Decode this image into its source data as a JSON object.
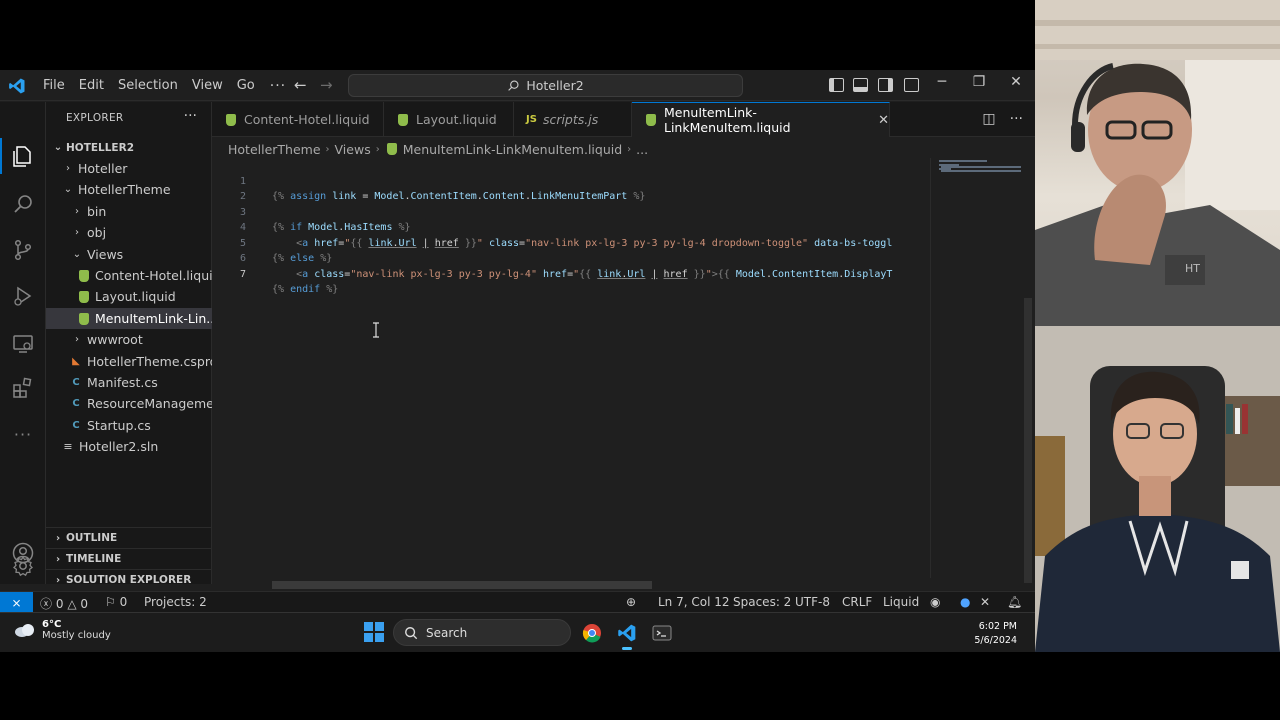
{
  "window": {
    "menu": [
      "File",
      "Edit",
      "Selection",
      "View",
      "Go"
    ],
    "command_center": "Hoteller2"
  },
  "explorer": {
    "header": "EXPLORER",
    "root": "HOTELLER2",
    "items": [
      {
        "label": "Hoteller",
        "type": "folder",
        "expanded": false
      },
      {
        "label": "HotellerTheme",
        "type": "folder",
        "expanded": true
      },
      {
        "label": "bin",
        "type": "folder",
        "expanded": false
      },
      {
        "label": "obj",
        "type": "folder",
        "expanded": false
      },
      {
        "label": "Views",
        "type": "folder",
        "expanded": true
      },
      {
        "label": "Content-Hotel.liquid",
        "type": "liquid"
      },
      {
        "label": "Layout.liquid",
        "type": "liquid"
      },
      {
        "label": "MenuItemLink-Lin...",
        "type": "liquid",
        "selected": true
      },
      {
        "label": "wwwroot",
        "type": "folder",
        "expanded": false
      },
      {
        "label": "HotellerTheme.csproj",
        "type": "csproj"
      },
      {
        "label": "Manifest.cs",
        "type": "cs"
      },
      {
        "label": "ResourceManageme...",
        "type": "cs"
      },
      {
        "label": "Startup.cs",
        "type": "cs"
      },
      {
        "label": "Hoteller2.sln",
        "type": "sln"
      }
    ],
    "panels": [
      "OUTLINE",
      "TIMELINE",
      "SOLUTION EXPLORER"
    ]
  },
  "tabs": [
    {
      "label": "Content-Hotel.liquid",
      "type": "liquid",
      "active": false
    },
    {
      "label": "Layout.liquid",
      "type": "liquid",
      "active": false
    },
    {
      "label": "scripts.js",
      "type": "js",
      "active": false
    },
    {
      "label": "MenuItemLink-LinkMenuItem.liquid",
      "type": "liquid",
      "active": true
    }
  ],
  "breadcrumb": [
    "HotellerTheme",
    "Views",
    "MenuItemLink-LinkMenuItem.liquid",
    "..."
  ],
  "editor": {
    "lines": [
      "{% assign link = Model.ContentItem.Content.LinkMenuItemPart %}",
      "",
      "{% if Model.HasItems %}",
      "    <a href=\"{{ link.Url | href }}\" class=\"nav-link px-lg-3 py-3 py-lg-4 dropdown-toggle\" data-bs-toggl",
      "{% else %}",
      "    <a class=\"nav-link px-lg-3 py-3 py-lg-4\" href=\"{{ link.Url | href }}\">{{ Model.ContentItem.DisplayT",
      "{% endif %}"
    ],
    "current_line": 7
  },
  "status": {
    "errors": "0",
    "warnings": "0",
    "info": "0",
    "projects": "Projects: 2",
    "position": "Ln 7, Col 12",
    "spaces": "Spaces: 2",
    "encoding": "UTF-8",
    "eol": "CRLF",
    "language": "Liquid"
  },
  "taskbar": {
    "temp": "6°C",
    "condition": "Mostly cloudy",
    "search": "Search",
    "time": "6:02 PM",
    "date": "5/6/2024"
  },
  "colors": {
    "accent": "#0078d4",
    "liquid": "#8fbc4b",
    "cs": "#519aba"
  }
}
